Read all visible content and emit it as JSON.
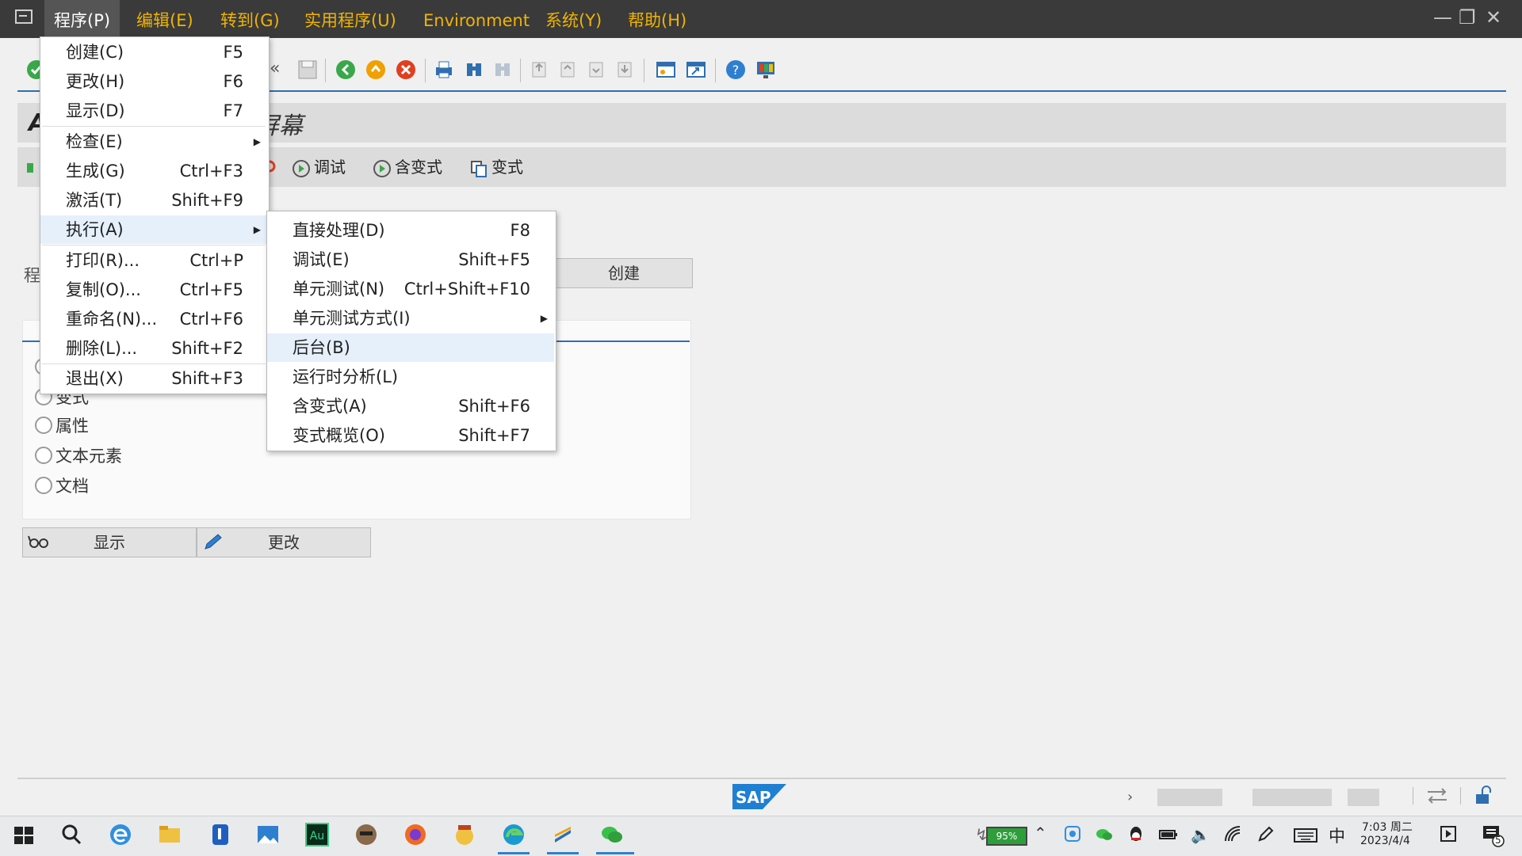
{
  "menubar": {
    "items": [
      {
        "label": "程序(P)",
        "underline": "P"
      },
      {
        "label": "编辑(E)",
        "underline": "E"
      },
      {
        "label": "转到(G)",
        "underline": "G"
      },
      {
        "label": "实用程序(U)",
        "underline": "U"
      },
      {
        "label": "Environment",
        "underline": "v"
      },
      {
        "label": "系统(Y)",
        "underline": "Y"
      },
      {
        "label": "帮助(H)",
        "underline": "H"
      }
    ]
  },
  "page_title_fragment": "屏幕",
  "app_toolbar": {
    "debug": "调试",
    "with_variant": "含变式",
    "variant": "变式"
  },
  "program_label": "程",
  "create_button": "创建",
  "subobjects": {
    "radios": [
      "变式",
      "属性",
      "文本元素",
      "文档"
    ]
  },
  "bottom_buttons": {
    "display": "显示",
    "change": "更改"
  },
  "program_menu": {
    "items": [
      {
        "label": "创建(C)",
        "shortcut": "F5"
      },
      {
        "label": "更改(H)",
        "shortcut": "F6"
      },
      {
        "label": "显示(D)",
        "shortcut": "F7"
      },
      {
        "label": "检查(E)",
        "shortcut": ""
      },
      {
        "label": "生成(G)",
        "shortcut": "Ctrl+F3"
      },
      {
        "label": "激活(T)",
        "shortcut": "Shift+F9"
      },
      {
        "label": "执行(A)",
        "shortcut": ""
      },
      {
        "label": "打印(R)...",
        "shortcut": "Ctrl+P"
      },
      {
        "label": "复制(O)...",
        "shortcut": "Ctrl+F5"
      },
      {
        "label": "重命名(N)...",
        "shortcut": "Ctrl+F6"
      },
      {
        "label": "删除(L)...",
        "shortcut": "Shift+F2"
      },
      {
        "label": "退出(X)",
        "shortcut": "Shift+F3"
      }
    ]
  },
  "execute_submenu": {
    "items": [
      {
        "label": "直接处理(D)",
        "shortcut": "F8"
      },
      {
        "label": "调试(E)",
        "shortcut": "Shift+F5"
      },
      {
        "label": "单元测试(N)",
        "shortcut": "Ctrl+Shift+F10"
      },
      {
        "label": "单元测试方式(I)",
        "shortcut": ""
      },
      {
        "label": "后台(B)",
        "shortcut": ""
      },
      {
        "label": "运行时分析(L)",
        "shortcut": ""
      },
      {
        "label": "含变式(A)",
        "shortcut": "Shift+F6"
      },
      {
        "label": "变式概览(O)",
        "shortcut": "Shift+F7"
      }
    ]
  },
  "statusbar": {
    "logo": "SAP"
  },
  "taskbar": {
    "battery": "95%",
    "ime": "中",
    "time": "7:03 周二",
    "date": "2023/4/4",
    "notifications": "5"
  },
  "colors": {
    "accent": "#2f6fb0",
    "menu_text": "#f0b400",
    "menubar_bg": "#3a3a3a"
  }
}
